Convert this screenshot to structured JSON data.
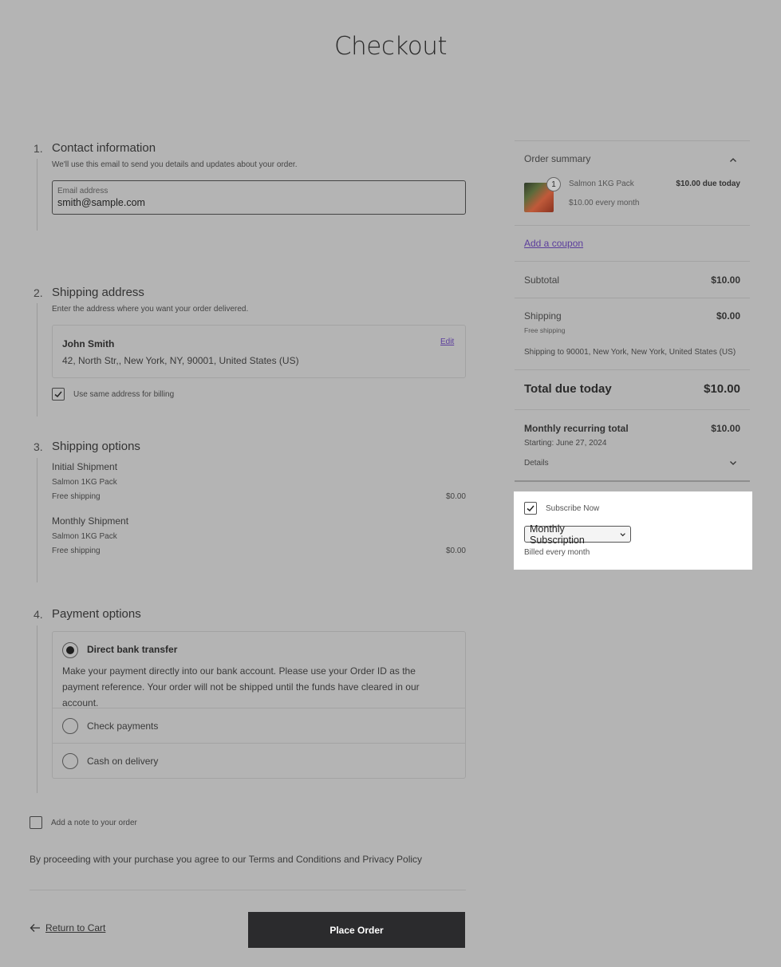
{
  "page": {
    "title": "Checkout"
  },
  "contact": {
    "number": "1.",
    "title": "Contact information",
    "description": "We'll use this email to send you details and updates about your order.",
    "email_label": "Email address",
    "email_value": "smith@sample.com"
  },
  "shipping_address": {
    "number": "2.",
    "title": "Shipping address",
    "description": "Enter the address where you want your order delivered.",
    "name": "John Smith",
    "address": "42, North Str,, New York, NY, 90001, United States (US)",
    "edit_label": "Edit",
    "billing_checkbox_label": "Use same address for billing",
    "billing_checked": true
  },
  "shipping_options": {
    "number": "3.",
    "title": "Shipping options",
    "groups": [
      {
        "title": "Initial Shipment",
        "item": "Salmon 1KG Pack",
        "method": "Free shipping",
        "price": "$0.00"
      },
      {
        "title": "Monthly Shipment",
        "item": "Salmon 1KG Pack",
        "method": "Free shipping",
        "price": "$0.00"
      }
    ]
  },
  "payment": {
    "number": "4.",
    "title": "Payment options",
    "methods": [
      {
        "label": "Direct bank transfer",
        "selected": true,
        "description": "Make your payment directly into our bank account. Please use your Order ID as the payment reference. Your order will not be shipped until the funds have cleared in our account."
      },
      {
        "label": "Check payments",
        "selected": false
      },
      {
        "label": "Cash on delivery",
        "selected": false
      }
    ]
  },
  "note": {
    "label": "Add a note to your order",
    "checked": false
  },
  "terms": {
    "text": "By proceeding with your purchase you agree to our Terms and Conditions and Privacy Policy"
  },
  "actions": {
    "return_label": "Return to Cart",
    "place_order_label": "Place Order"
  },
  "summary": {
    "title": "Order summary",
    "product": {
      "quantity": "1",
      "name": "Salmon 1KG Pack",
      "price": "$10.00 due today",
      "recurring": "$10.00 every month"
    },
    "coupon_label": "Add a coupon",
    "subtotal_label": "Subtotal",
    "subtotal_value": "$10.00",
    "shipping_label": "Shipping",
    "shipping_value": "$0.00",
    "shipping_method": "Free shipping",
    "shipping_to": "Shipping to 90001, New York, New York, United States (US)",
    "total_label": "Total due today",
    "total_value": "$10.00",
    "recurring_label": "Monthly recurring total",
    "recurring_value": "$10.00",
    "recurring_start": "Starting: June 27, 2024",
    "details_label": "Details"
  },
  "subscription": {
    "checkbox_label": "Subscribe Now",
    "checked": true,
    "selected_option": "Monthly Subscription",
    "billing_note": "Billed every month"
  }
}
